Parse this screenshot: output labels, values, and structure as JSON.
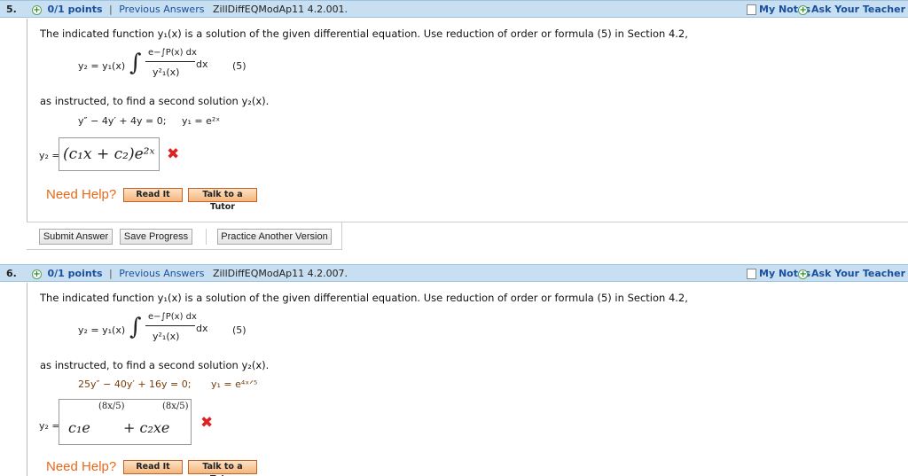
{
  "questions": [
    {
      "number": "5.",
      "points": "0/1 points",
      "separator": "|",
      "previous_answers": "Previous Answers",
      "qid": "ZillDiffEQModAp11 4.2.001.",
      "my_notes": "My Notes",
      "ask_teacher": "Ask Your Teacher",
      "intro": "The indicated function y₁(x) is a solution of the given differential equation. Use reduction of order or formula (5) in Section 4.2,",
      "formula_lhs": "y₂ = y₁(x)",
      "formula_num": "e−∫P(x) dx",
      "formula_den": "y²₁(x)",
      "formula_dx": "dx",
      "formula_tag": "(5)",
      "instruction": "as instructed, to find a second solution y₂(x).",
      "equation": "y″ − 4y′ + 4y = 0;",
      "y1": "y₁ = e²ˣ",
      "answer_label": "y₂ =",
      "answer": "(c₁x + c₂)e²ˣ",
      "result": "✖",
      "need_help": "Need Help?",
      "read_it": "Read It",
      "talk_tutor": "Talk to a Tutor"
    },
    {
      "number": "6.",
      "points": "0/1 points",
      "separator": "|",
      "previous_answers": "Previous Answers",
      "qid": "ZillDiffEQModAp11 4.2.007.",
      "my_notes": "My Notes",
      "ask_teacher": "Ask Your Teacher",
      "intro": "The indicated function y₁(x) is a solution of the given differential equation. Use reduction of order or formula (5) in Section 4.2,",
      "formula_lhs": "y₂ = y₁(x)",
      "formula_num": "e−∫P(x) dx",
      "formula_den": "y²₁(x)",
      "formula_dx": "dx",
      "formula_tag": "(5)",
      "instruction": "as instructed, to find a second solution y₂(x).",
      "equation": "25y″ − 40y′ + 16y = 0;",
      "y1": "y₁ = e⁴ˣᐟ⁵",
      "answer_label": "y₂ =",
      "answer_part1": "c₁e",
      "answer_exp1": "8x/5",
      "answer_part2": "+ c₂xe",
      "answer_exp2": "8x/5",
      "result": "✖",
      "need_help": "Need Help?",
      "read_it": "Read It",
      "talk_tutor": "Talk to a Tutor"
    }
  ],
  "actions": {
    "submit": "Submit Answer",
    "save": "Save Progress",
    "practice": "Practice Another Version"
  },
  "colors": {
    "header_bg": "#c7dff0",
    "link": "#1a4f9c",
    "help_orange": "#e8681a",
    "wrong_red": "#dd2222"
  }
}
